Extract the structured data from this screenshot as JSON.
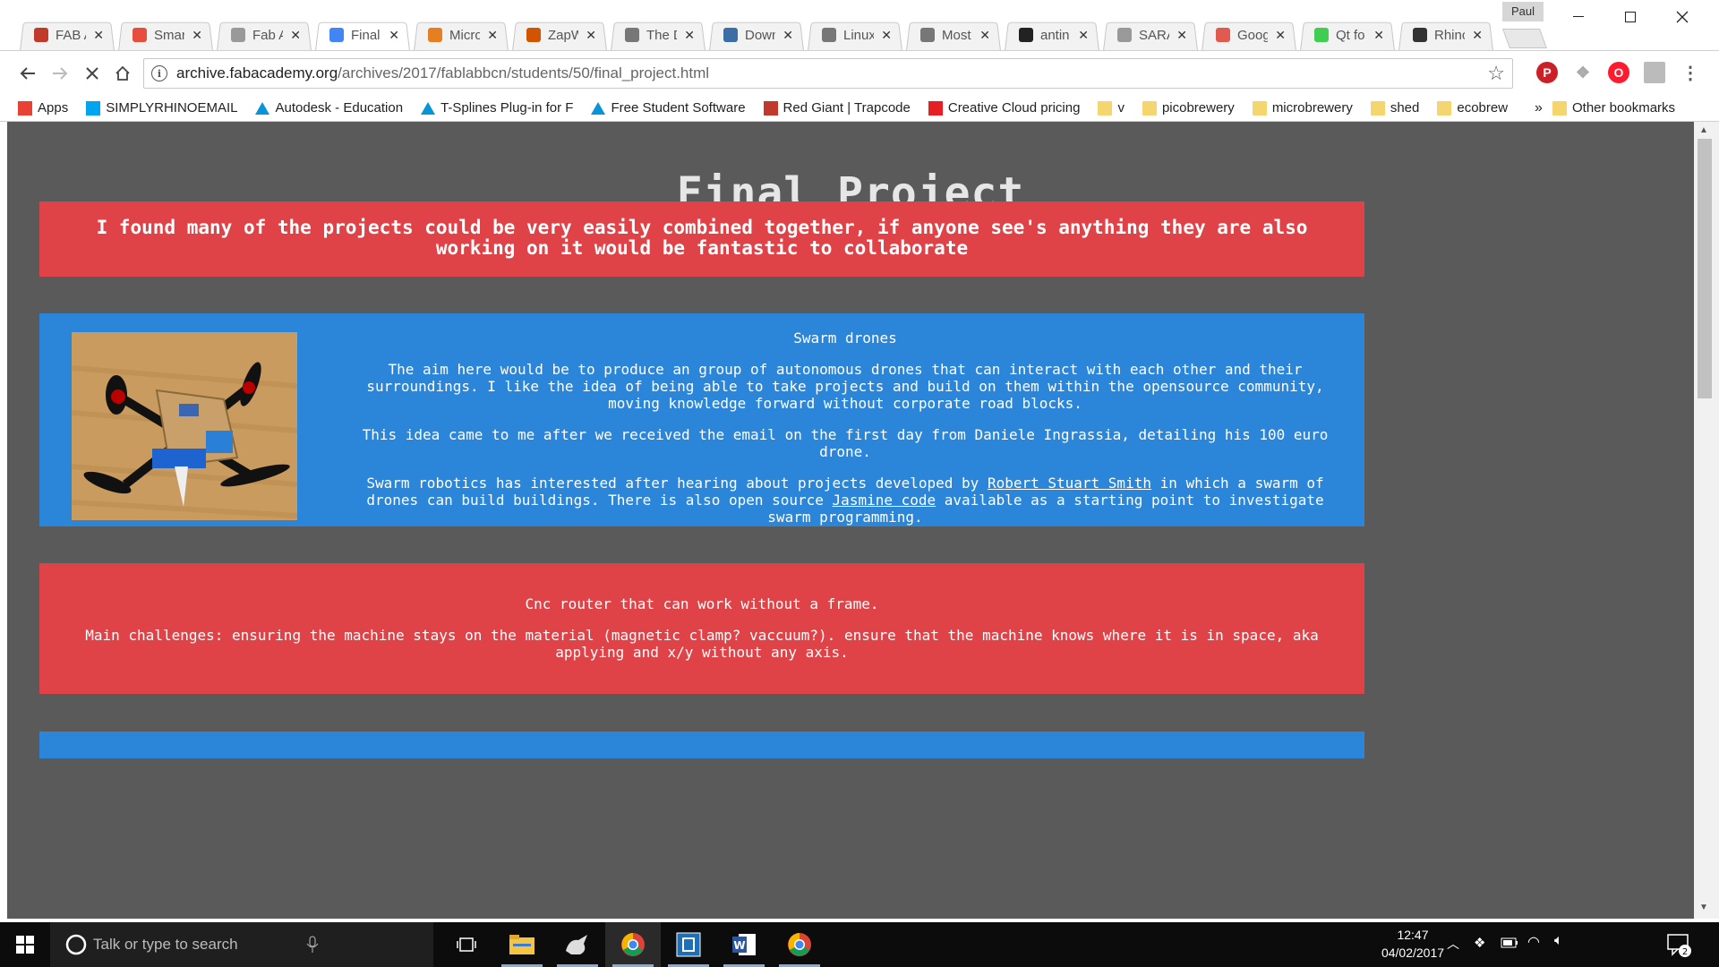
{
  "browser": {
    "profile": "Paul",
    "tabs": [
      {
        "title": "FAB A",
        "color": "#c0392b"
      },
      {
        "title": "Smar",
        "color": "#e74c3c"
      },
      {
        "title": "Fab A",
        "color": "#999999"
      },
      {
        "title": "Final",
        "color": "#4285f4"
      },
      {
        "title": "Micro",
        "color": "#e67e22"
      },
      {
        "title": "ZapW",
        "color": "#d35400"
      },
      {
        "title": "The D",
        "color": "#777777"
      },
      {
        "title": "Down",
        "color": "#3a6ea5"
      },
      {
        "title": "Linux",
        "color": "#777777"
      },
      {
        "title": "Most",
        "color": "#777777"
      },
      {
        "title": "antin",
        "color": "#222222"
      },
      {
        "title": "SARA",
        "color": "#999999"
      },
      {
        "title": "Goog",
        "color": "#e05a4f"
      },
      {
        "title": "Qt fo",
        "color": "#41cd52"
      },
      {
        "title": "Rhino",
        "color": "#333333"
      }
    ],
    "url_host": "archive.fabacademy.org",
    "url_path": "/archives/2017/fablabbcn/students/50/final_project.html",
    "bookmarks": [
      {
        "label": "Apps",
        "icon": "apps-grid-icon"
      },
      {
        "label": "SIMPLYRHINOEMAIL",
        "icon": "windows-logo-icon"
      },
      {
        "label": "Autodesk - Education",
        "icon": "autodesk-icon"
      },
      {
        "label": "T-Splines Plug-in for F",
        "icon": "autodesk-icon"
      },
      {
        "label": "Free Student Software",
        "icon": "autodesk-icon"
      },
      {
        "label": "Red Giant | Trapcode",
        "icon": "redgiant-icon"
      },
      {
        "label": "Creative Cloud pricing",
        "icon": "adobe-icon"
      },
      {
        "label": "v",
        "icon": "folder-icon"
      },
      {
        "label": "picobrewery",
        "icon": "folder-icon"
      },
      {
        "label": "microbrewery",
        "icon": "folder-icon"
      },
      {
        "label": "shed",
        "icon": "folder-icon"
      },
      {
        "label": "ecobrew",
        "icon": "folder-icon"
      }
    ],
    "bookmarks_overflow": "»",
    "other_bookmarks": "Other bookmarks"
  },
  "page": {
    "title": "Final Project",
    "intro": "I found many of the projects could be very easily combined together, if anyone see's anything they are also working on it would be fantastic to collaborate",
    "drones": {
      "heading": "Swarm drones",
      "p1": "The aim here would be to produce an group of autonomous drones that can interact with each other and their surroundings. I like the idea of being able to take projects and build on them within the opensource community, moving knowledge forward without corporate road blocks.",
      "p2": "This idea came to me after we received the email on the first day from Daniele Ingrassia, detailing his 100 euro drone.",
      "p3_a": "Swarm robotics has interested after hearing about projects developed by ",
      "p3_link1": "Robert Stuart Smith",
      "p3_b": " in which a swarm of drones can build buildings. There is also open source ",
      "p3_link2": "Jasmine code",
      "p3_c": " available as a starting point to investigate swarm programming."
    },
    "cnc": {
      "heading": "Cnc router that can work without a frame.",
      "body": "Main challenges: ensuring the machine stays on the material (magnetic clamp? vaccuum?). ensure that the machine knows where it is in space, aka applying and x/y without any axis."
    }
  },
  "taskbar": {
    "search_placeholder": "Talk or type to search",
    "time": "12:47",
    "date": "04/02/2017",
    "notifications": "2"
  }
}
